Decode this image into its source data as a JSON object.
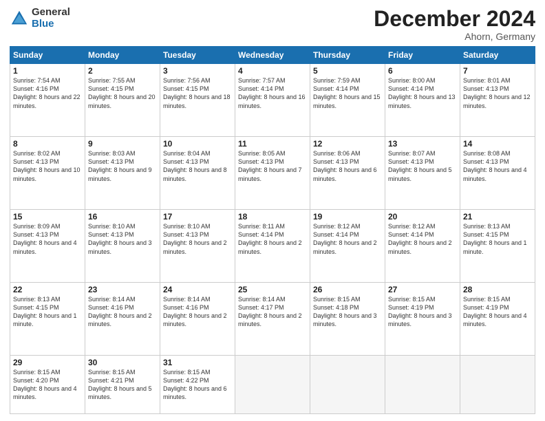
{
  "logo": {
    "general": "General",
    "blue": "Blue"
  },
  "title": "December 2024",
  "location": "Ahorn, Germany",
  "days_header": [
    "Sunday",
    "Monday",
    "Tuesday",
    "Wednesday",
    "Thursday",
    "Friday",
    "Saturday"
  ],
  "weeks": [
    [
      {
        "day": "1",
        "sunrise": "7:54 AM",
        "sunset": "4:16 PM",
        "daylight": "8 hours and 22 minutes."
      },
      {
        "day": "2",
        "sunrise": "7:55 AM",
        "sunset": "4:15 PM",
        "daylight": "8 hours and 20 minutes."
      },
      {
        "day": "3",
        "sunrise": "7:56 AM",
        "sunset": "4:15 PM",
        "daylight": "8 hours and 18 minutes."
      },
      {
        "day": "4",
        "sunrise": "7:57 AM",
        "sunset": "4:14 PM",
        "daylight": "8 hours and 16 minutes."
      },
      {
        "day": "5",
        "sunrise": "7:59 AM",
        "sunset": "4:14 PM",
        "daylight": "8 hours and 15 minutes."
      },
      {
        "day": "6",
        "sunrise": "8:00 AM",
        "sunset": "4:14 PM",
        "daylight": "8 hours and 13 minutes."
      },
      {
        "day": "7",
        "sunrise": "8:01 AM",
        "sunset": "4:13 PM",
        "daylight": "8 hours and 12 minutes."
      }
    ],
    [
      {
        "day": "8",
        "sunrise": "8:02 AM",
        "sunset": "4:13 PM",
        "daylight": "8 hours and 10 minutes."
      },
      {
        "day": "9",
        "sunrise": "8:03 AM",
        "sunset": "4:13 PM",
        "daylight": "8 hours and 9 minutes."
      },
      {
        "day": "10",
        "sunrise": "8:04 AM",
        "sunset": "4:13 PM",
        "daylight": "8 hours and 8 minutes."
      },
      {
        "day": "11",
        "sunrise": "8:05 AM",
        "sunset": "4:13 PM",
        "daylight": "8 hours and 7 minutes."
      },
      {
        "day": "12",
        "sunrise": "8:06 AM",
        "sunset": "4:13 PM",
        "daylight": "8 hours and 6 minutes."
      },
      {
        "day": "13",
        "sunrise": "8:07 AM",
        "sunset": "4:13 PM",
        "daylight": "8 hours and 5 minutes."
      },
      {
        "day": "14",
        "sunrise": "8:08 AM",
        "sunset": "4:13 PM",
        "daylight": "8 hours and 4 minutes."
      }
    ],
    [
      {
        "day": "15",
        "sunrise": "8:09 AM",
        "sunset": "4:13 PM",
        "daylight": "8 hours and 4 minutes."
      },
      {
        "day": "16",
        "sunrise": "8:10 AM",
        "sunset": "4:13 PM",
        "daylight": "8 hours and 3 minutes."
      },
      {
        "day": "17",
        "sunrise": "8:10 AM",
        "sunset": "4:13 PM",
        "daylight": "8 hours and 2 minutes."
      },
      {
        "day": "18",
        "sunrise": "8:11 AM",
        "sunset": "4:14 PM",
        "daylight": "8 hours and 2 minutes."
      },
      {
        "day": "19",
        "sunrise": "8:12 AM",
        "sunset": "4:14 PM",
        "daylight": "8 hours and 2 minutes."
      },
      {
        "day": "20",
        "sunrise": "8:12 AM",
        "sunset": "4:14 PM",
        "daylight": "8 hours and 2 minutes."
      },
      {
        "day": "21",
        "sunrise": "8:13 AM",
        "sunset": "4:15 PM",
        "daylight": "8 hours and 1 minute."
      }
    ],
    [
      {
        "day": "22",
        "sunrise": "8:13 AM",
        "sunset": "4:15 PM",
        "daylight": "8 hours and 1 minute."
      },
      {
        "day": "23",
        "sunrise": "8:14 AM",
        "sunset": "4:16 PM",
        "daylight": "8 hours and 2 minutes."
      },
      {
        "day": "24",
        "sunrise": "8:14 AM",
        "sunset": "4:16 PM",
        "daylight": "8 hours and 2 minutes."
      },
      {
        "day": "25",
        "sunrise": "8:14 AM",
        "sunset": "4:17 PM",
        "daylight": "8 hours and 2 minutes."
      },
      {
        "day": "26",
        "sunrise": "8:15 AM",
        "sunset": "4:18 PM",
        "daylight": "8 hours and 3 minutes."
      },
      {
        "day": "27",
        "sunrise": "8:15 AM",
        "sunset": "4:19 PM",
        "daylight": "8 hours and 3 minutes."
      },
      {
        "day": "28",
        "sunrise": "8:15 AM",
        "sunset": "4:19 PM",
        "daylight": "8 hours and 4 minutes."
      }
    ],
    [
      {
        "day": "29",
        "sunrise": "8:15 AM",
        "sunset": "4:20 PM",
        "daylight": "8 hours and 4 minutes."
      },
      {
        "day": "30",
        "sunrise": "8:15 AM",
        "sunset": "4:21 PM",
        "daylight": "8 hours and 5 minutes."
      },
      {
        "day": "31",
        "sunrise": "8:15 AM",
        "sunset": "4:22 PM",
        "daylight": "8 hours and 6 minutes."
      },
      null,
      null,
      null,
      null
    ]
  ]
}
